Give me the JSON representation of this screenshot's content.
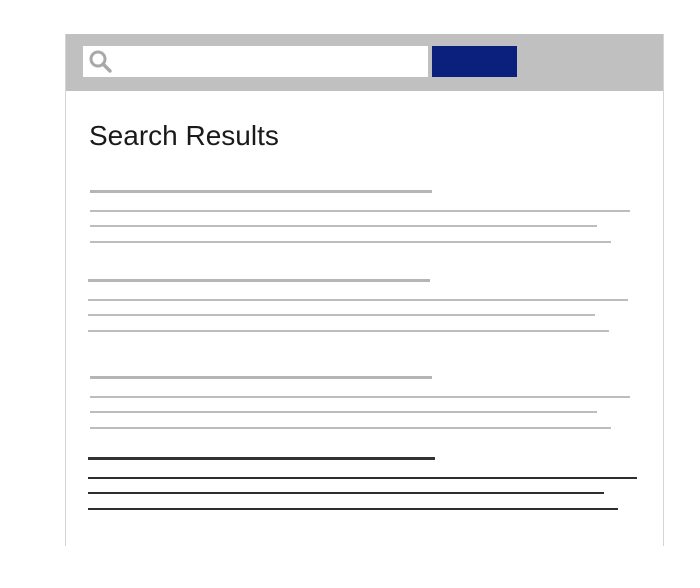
{
  "colors": {
    "topbar": "#c0c0c0",
    "search_button": "#0b1f7d",
    "placeholder_line": "#bdbdbd",
    "placeholder_title_line": "#b5b5b5",
    "highlighted_line": "#2e2e2e",
    "highlighted_title_line": "#333333"
  },
  "search": {
    "placeholder": "",
    "value": "",
    "icon": "search-icon"
  },
  "search_button": {
    "label": ""
  },
  "page": {
    "title": "Search Results"
  },
  "results": [
    {
      "state": "placeholder",
      "snippet_lines": 3
    },
    {
      "state": "placeholder",
      "snippet_lines": 3
    },
    {
      "state": "placeholder",
      "snippet_lines": 3
    },
    {
      "state": "highlighted",
      "snippet_lines": 3
    }
  ]
}
